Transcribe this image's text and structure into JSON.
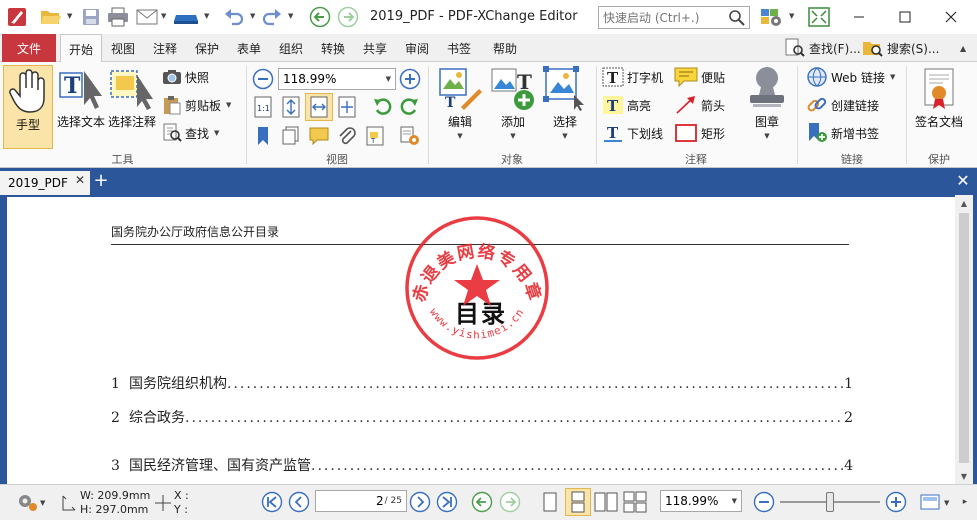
{
  "window": {
    "title": "2019_PDF - PDF-XChange Editor",
    "quick_launch_placeholder": "快速启动 (Ctrl+.)"
  },
  "ribbon_tabs": {
    "file": "文件",
    "tabs": [
      "开始",
      "视图",
      "注释",
      "保护",
      "表单",
      "组织",
      "转换",
      "共享",
      "审阅",
      "书签",
      "帮助"
    ],
    "active": "开始",
    "find": "查找(F)...",
    "search": "搜索(S)..."
  },
  "ribbon": {
    "tools": {
      "label": "工具",
      "hand": "手型",
      "select_text": "选择文本",
      "select_annotation": "选择注释",
      "snapshot": "快照",
      "clipboard": "剪贴板",
      "find": "查找"
    },
    "view": {
      "label": "视图",
      "zoom": "118.99%"
    },
    "objects": {
      "label": "对象",
      "edit": "编辑",
      "add": "添加",
      "select": "选择"
    },
    "comments": {
      "label": "注释",
      "typewriter": "打字机",
      "sticky_note": "便贴",
      "highlight": "高亮",
      "arrow": "箭头",
      "underline": "下划线",
      "rectangle": "矩形",
      "stamp": "图章"
    },
    "links": {
      "label": "链接",
      "web_links": "Web 链接",
      "create_link": "创建链接",
      "add_bookmark": "新增书签"
    },
    "protect": {
      "label": "保护",
      "sign": "签名文档"
    }
  },
  "document_tab": {
    "name": "2019_PDF"
  },
  "page": {
    "header": "国务院办公厅政府信息公开目录",
    "title": "目录",
    "stamp_text": "赤退美网络专用章",
    "stamp_url": "www.yishimei.cn",
    "toc": [
      {
        "num": "1",
        "text": "国务院组织机构",
        "page": "1"
      },
      {
        "num": "2",
        "text": "综合政务",
        "page": "2"
      },
      {
        "num": "3",
        "text": "国民经济管理、国有资产监管",
        "page": "4"
      }
    ],
    "dots": "................................................................................................................................"
  },
  "status": {
    "width": "W: 209.9mm",
    "height": "H: 297.0mm",
    "x": "X :",
    "y": "Y :",
    "current_page": "2",
    "total_pages": "/ 25",
    "zoom": "118.99%"
  },
  "colors": {
    "file_tab": "#c8373e",
    "doc_background": "#2b579a",
    "stamp_red": "#e8232a"
  },
  "icons": [
    "app-logo-icon",
    "open-folder-icon",
    "save-icon",
    "print-icon",
    "email-icon",
    "scan-icon",
    "undo-icon",
    "redo-icon",
    "back-icon",
    "forward-icon",
    "search-icon",
    "ui-options-icon",
    "fullscreen-icon",
    "hand-icon",
    "select-text-icon",
    "select-annotation-icon",
    "camera-icon",
    "clipboard-icon",
    "find-icon",
    "zoom-out-icon",
    "zoom-in-icon",
    "stamp-icon",
    "certificate-icon",
    "settings-icon",
    "link-icon",
    "bookmark-icon"
  ]
}
